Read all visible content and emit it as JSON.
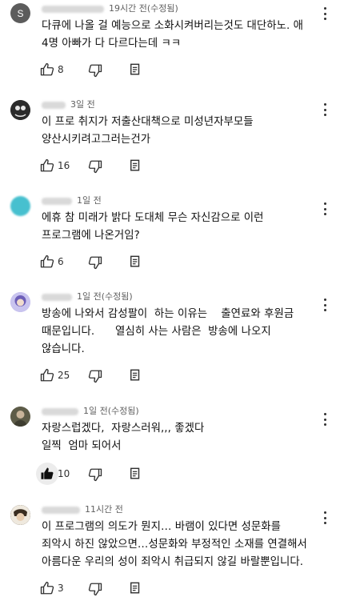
{
  "comments": [
    {
      "avatar_letter": "S",
      "avatar_color": "#5c5c5c",
      "time": "19시간 전(수정됨)",
      "lines": [
        "다큐에 나올 걸 예능으로 소화시켜버리는것도 대단하노. 애",
        "4명 아빠가 다 다르다는데 ㅋㅋ"
      ],
      "likes": "8",
      "liked": false
    },
    {
      "avatar_letter": "",
      "avatar_color": "#2b2b2b",
      "time": "3일 전",
      "lines": [
        "이 프로 취지가 저출산대책으로 미성년자부모들",
        "양산시키려고그러는건가"
      ],
      "likes": "16",
      "liked": false
    },
    {
      "avatar_letter": "",
      "avatar_color": "#47c0cf",
      "time": "1일 전",
      "lines": [
        "에휴 참 미래가 밝다 도대체 무슨 자신감으로 이런",
        "프로그램에 나온거임?"
      ],
      "likes": "6",
      "liked": false
    },
    {
      "avatar_letter": "",
      "avatar_color": "#8a7fc9",
      "time": "1일 전(수정됨)",
      "lines": [
        "방송에 나와서 감성팔이  하는 이유는    출연료와 후원금",
        "때문입니다.      열심히 사는 사람은  방송에 나오지",
        "않습니다."
      ],
      "likes": "25",
      "liked": false
    },
    {
      "avatar_letter": "",
      "avatar_color": "#6b6a55",
      "time": "1일 전(수정됨)",
      "lines": [
        "자랑스럽겠다,  자랑스러워,,, 좋겠다",
        "일찍  엄마 되어서"
      ],
      "likes": "10",
      "liked": true
    },
    {
      "avatar_letter": "",
      "avatar_color": "#4a3b2c",
      "time": "11시간 전",
      "lines": [
        "이 프로그램의 의도가 뭔지… 바램이 있다면 성문화를",
        "죄악시 하진 않았으면…성문화와 부정적인 소재를 연결해서",
        "아름다운 우리의 성이 죄악시 취급되지 않길 바랄뿐입니다."
      ],
      "likes": "3",
      "liked": false
    }
  ]
}
